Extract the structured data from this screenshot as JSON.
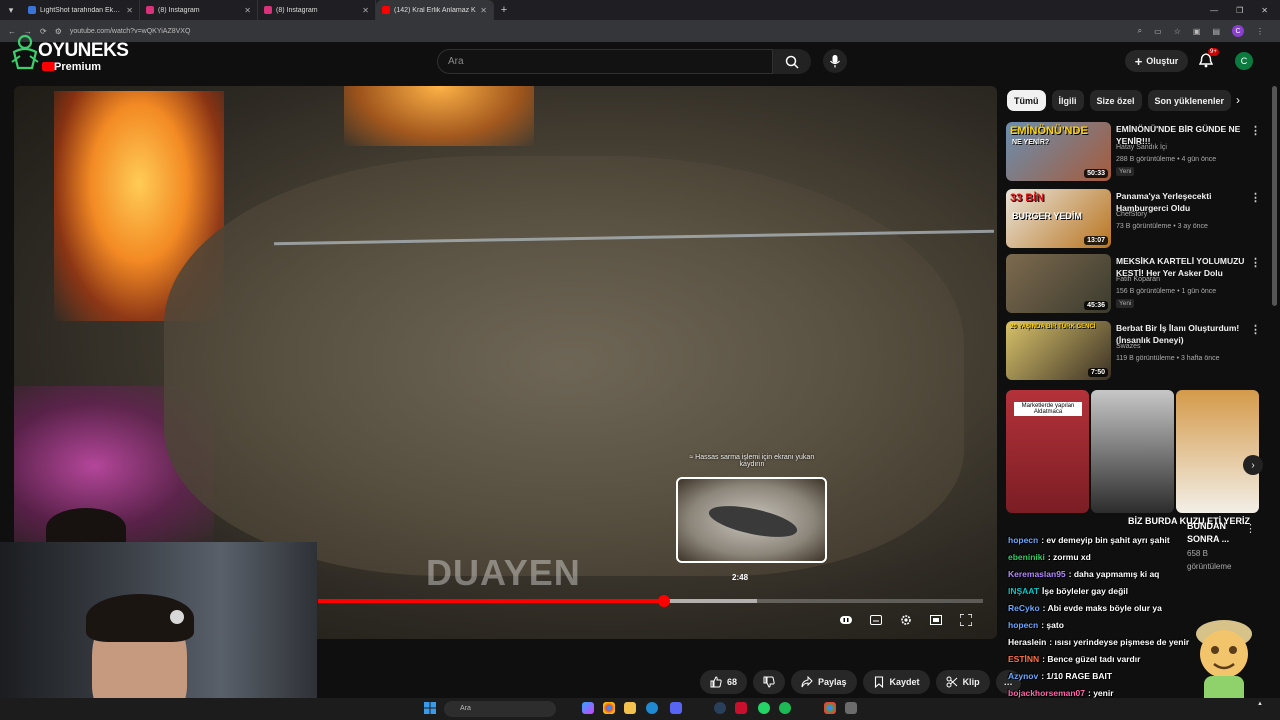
{
  "browser": {
    "tabs": [
      {
        "title": "LightShot tarafından Ekran Gör",
        "color": "#3b74d8",
        "active": false
      },
      {
        "title": "(8) Instagram",
        "color": "#d9317a",
        "active": false
      },
      {
        "title": "(8) Instagram",
        "color": "#d9317a",
        "active": false
      },
      {
        "title": "(142) Kral Erlik Anlamaz K",
        "color": "#ff0000",
        "active": true
      }
    ],
    "new_tab": "+",
    "url": "youtube.com/watch?v=wQKYiAZ8VXQ",
    "profile_initial": "C"
  },
  "header": {
    "brand": "OYUNEKS",
    "premium": "Premium",
    "search_placeholder": "Ara",
    "create_label": "Oluştur",
    "notif_badge": "9+",
    "avatar_initial": "C"
  },
  "player": {
    "watermark": "DUAYEN",
    "seek_hint": "≈ Hassas sarma işlemi için ekranı yukarı kaydırın",
    "preview_time": "2:48",
    "played_fraction": 0.52,
    "buffered_fraction": 0.66,
    "hover_fraction": 0.655
  },
  "actions": {
    "likes": "68",
    "share": "Paylaş",
    "save": "Kaydet",
    "clip": "Klip",
    "more": "…"
  },
  "chips": [
    "Tümü",
    "İlgili",
    "Size özel",
    "Son yüklenenler"
  ],
  "recommendations": [
    {
      "title": "EMİNÖNÜ'NDE BİR GÜNDE NE YENİR!!!",
      "channel": "Hatay Sandık İçi",
      "meta": "288 B görüntüleme • 4 gün önce",
      "duration": "50:33",
      "badge": "Yeni",
      "overlay": "EMİNÖNÜ'NDE",
      "overlay2": "NE YENİR?",
      "bg1": "#6a8fb0",
      "bg2": "#a65b3b"
    },
    {
      "title": "Panama'ya Yerleşecekti Hamburgerci Oldu",
      "channel": "ChefStory",
      "meta": "73 B görüntüleme • 3 ay önce",
      "duration": "13:07",
      "badge": "",
      "overlay": "33 BİN",
      "overlay2": "BURGER YEDİM",
      "bg1": "#e9e4da",
      "bg2": "#b8741f"
    },
    {
      "title": "MEKSİKA KARTELİ YOLUMUZU KESTİ! Her Yer Asker Dolu",
      "channel": "Fatih Koparan",
      "meta": "156 B görüntüleme • 1 gün önce",
      "duration": "45:36",
      "badge": "Yeni",
      "overlay": "",
      "overlay2": "",
      "bg1": "#7d6a4e",
      "bg2": "#3b3b2f"
    },
    {
      "title": "Berbat Bir İş İlanı Oluşturdum! (İnsanlık Deneyi)",
      "channel": "Swazes",
      "meta": "119 B görüntüleme • 3 hafta önce",
      "duration": "7:50",
      "badge": "",
      "overlay": "20 YAŞINDA BİR TÜRK GENCİ",
      "overlay2": "",
      "bg1": "#d8c26a",
      "bg2": "#3b3126"
    }
  ],
  "shelf": {
    "cards": [
      {
        "label": "Marketlerde yapılan Aldatmaca",
        "bg1": "#b4323a",
        "bg2": "#7b1d24"
      },
      {
        "label": "",
        "bg1": "#c7c7c7",
        "bg2": "#2c2c2c"
      },
      {
        "label": "",
        "bg1": "#d49a4a",
        "bg2": "#f3efe7"
      }
    ],
    "caption1": "BİZ BURDA KUZU ETİ YERİZ",
    "caption2": "BUNDAN SONRA ...",
    "views2": "658 B",
    "views_label": "görüntüleme"
  },
  "chat": [
    {
      "name": "hopecn",
      "text": ": ev demeyip bin şahit ayrı şahit",
      "color": "#6aa8ff"
    },
    {
      "name": "ebeniniki",
      "text": ": zormu xd",
      "color": "#33cc66"
    },
    {
      "name": "Keremaslan95",
      "text": ": daha yapmamış ki aq",
      "color": "#b388ff"
    },
    {
      "name": "INŞAAT",
      "text": "İşe böyleler gay değil",
      "color": "#00c8c8"
    },
    {
      "name": "ReCyko",
      "text": ": Abi evde maks böyle olur ya",
      "color": "#6aa8ff"
    },
    {
      "name": "hopecn",
      "text": ": şato",
      "color": "#6aa8ff"
    },
    {
      "name": "Heraslein",
      "text": ": ısısı yerindeyse pişmese de yenir",
      "color": "#ffffff"
    },
    {
      "name": "ESTİNN",
      "text": ": Bence güzel tadı vardır",
      "color": "#ff7043"
    },
    {
      "name": "Azynov",
      "text": ": 1/10 RAGE BAIT",
      "color": "#6aa8ff"
    },
    {
      "name": "bojackhorseman07",
      "text": ": yenir",
      "color": "#ff66aa"
    }
  ],
  "taskbar": {
    "search": "Ara"
  }
}
